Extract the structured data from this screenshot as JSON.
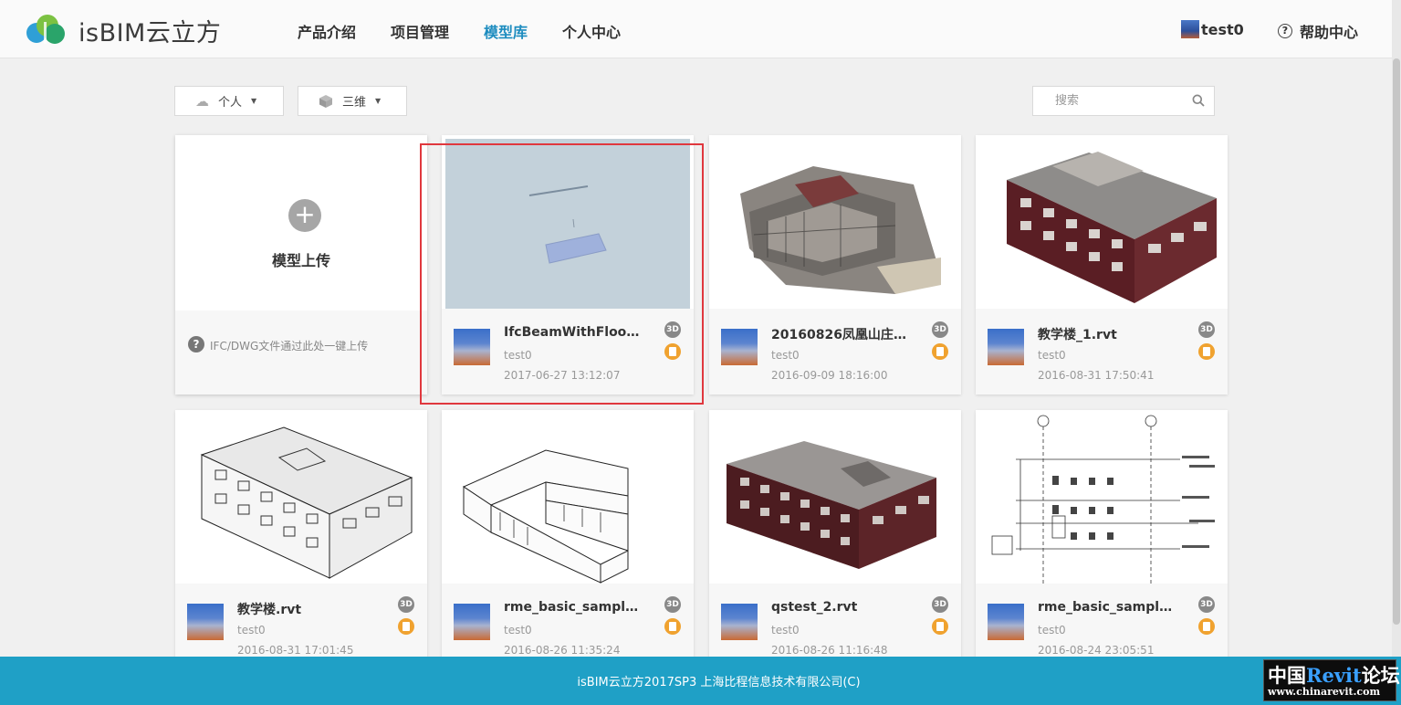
{
  "header": {
    "brand": "isBIM云立方",
    "nav": [
      "产品介绍",
      "项目管理",
      "模型库",
      "个人中心"
    ],
    "active_nav": "模型库",
    "user": "test0",
    "help": "帮助中心"
  },
  "toolbar": {
    "scope_label": "个人",
    "view_label": "三维",
    "search_placeholder": "搜索"
  },
  "upload": {
    "label": "模型上传",
    "hint": "IFC/DWG文件通过此处一键上传"
  },
  "models": [
    {
      "title": "IfcBeamWithFloor...",
      "owner": "test0",
      "date": "2017-06-27 13:12:07",
      "badge": "3D",
      "thumb": "beam-floor"
    },
    {
      "title": "20160826凤凰山庄_...",
      "owner": "test0",
      "date": "2016-09-09 18:16:00",
      "badge": "3D",
      "thumb": "villa"
    },
    {
      "title": "教学楼_1.rvt",
      "owner": "test0",
      "date": "2016-08-31 17:50:41",
      "badge": "3D",
      "thumb": "school-red"
    },
    {
      "title": "教学楼.rvt",
      "owner": "test0",
      "date": "2016-08-31 17:01:45",
      "badge": "3D",
      "thumb": "school-line"
    },
    {
      "title": "rme_basic_sample_...",
      "owner": "test0",
      "date": "2016-08-26 11:35:24",
      "badge": "3D",
      "thumb": "rme-line"
    },
    {
      "title": "qstest_2.rvt",
      "owner": "test0",
      "date": "2016-08-26 11:16:48",
      "badge": "3D",
      "thumb": "qstest"
    },
    {
      "title": "rme_basic_sample_...",
      "owner": "test0",
      "date": "2016-08-24 23:05:51",
      "badge": "3D",
      "thumb": "rme-drawing"
    }
  ],
  "footer": "isBIM云立方2017SP3 上海比程信息技术有限公司(C)",
  "watermark": {
    "cn_left": "中国",
    "revit": "Revit",
    "cn_right": "论坛",
    "url": "www.chinarevit.com"
  },
  "colors": {
    "accent": "#1d8cbf",
    "footer": "#1fa0c6",
    "highlight": "#e0383e",
    "doc_badge": "#f0a22f"
  }
}
